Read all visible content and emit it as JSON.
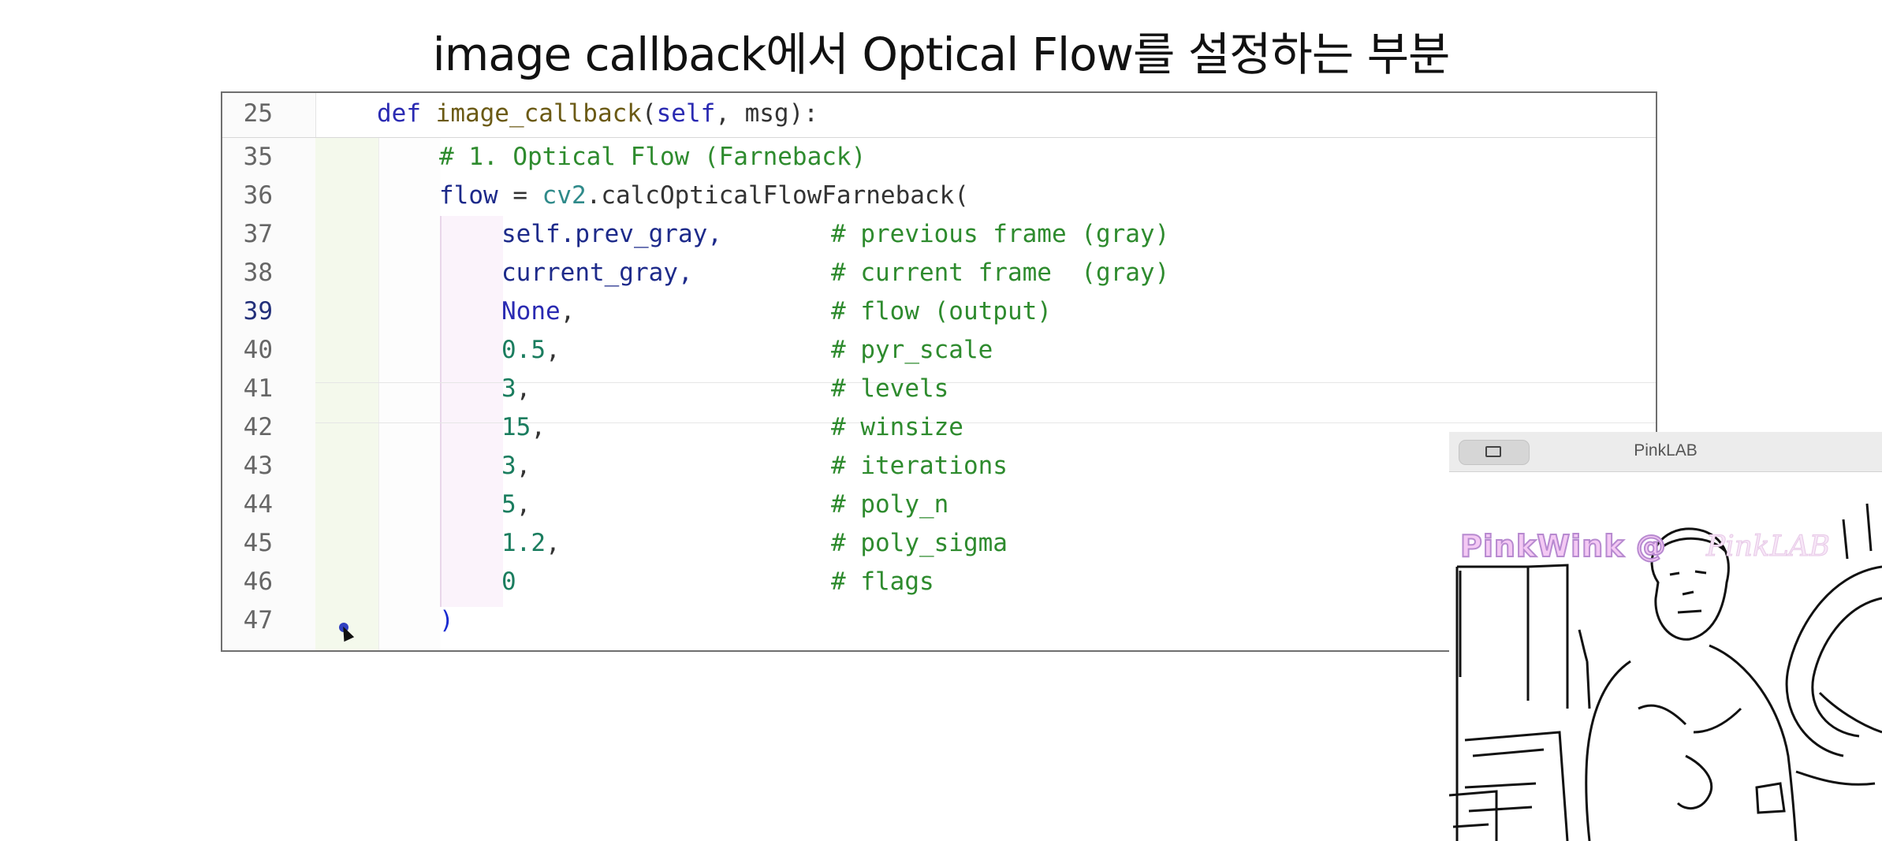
{
  "slide": {
    "title": "image callback에서 Optical Flow를 설정하는 부분"
  },
  "editor": {
    "current_line": "39",
    "lines": [
      {
        "n": "25",
        "indent": 0,
        "segs": [
          [
            "kw",
            "def "
          ],
          [
            "fn",
            "image_callback"
          ],
          [
            "plain",
            "("
          ],
          [
            "self",
            "self"
          ],
          [
            "plain",
            ", msg):"
          ]
        ]
      },
      {
        "n": "35",
        "indent": 1,
        "segs": [
          [
            "cm",
            "# 1. Optical Flow (Farneback)"
          ]
        ]
      },
      {
        "n": "36",
        "indent": 1,
        "segs": [
          [
            "var",
            "flow"
          ],
          [
            "plain",
            " = "
          ],
          [
            "mod",
            "cv2"
          ],
          [
            "plain",
            ".calcOpticalFlowFarneback("
          ]
        ]
      },
      {
        "n": "37",
        "indent": 2,
        "segs": [
          [
            "var",
            "self.prev_gray,"
          ]
        ],
        "comment": "# previous frame (gray)"
      },
      {
        "n": "38",
        "indent": 2,
        "segs": [
          [
            "var",
            "current_gray,"
          ]
        ],
        "comment": "# current frame  (gray)"
      },
      {
        "n": "39",
        "indent": 2,
        "segs": [
          [
            "kw",
            "None"
          ],
          [
            "plain",
            ","
          ]
        ],
        "comment": "# flow (output)"
      },
      {
        "n": "40",
        "indent": 2,
        "segs": [
          [
            "num",
            "0.5"
          ],
          [
            "plain",
            ","
          ]
        ],
        "comment": "# pyr_scale"
      },
      {
        "n": "41",
        "indent": 2,
        "segs": [
          [
            "num",
            "3"
          ],
          [
            "plain",
            ","
          ]
        ],
        "comment": "# levels"
      },
      {
        "n": "42",
        "indent": 2,
        "segs": [
          [
            "num",
            "15"
          ],
          [
            "plain",
            ","
          ]
        ],
        "comment": "# winsize"
      },
      {
        "n": "43",
        "indent": 2,
        "segs": [
          [
            "num",
            "3"
          ],
          [
            "plain",
            ","
          ]
        ],
        "comment": "# iterations"
      },
      {
        "n": "44",
        "indent": 2,
        "segs": [
          [
            "num",
            "5"
          ],
          [
            "plain",
            ","
          ]
        ],
        "comment": "# poly_n"
      },
      {
        "n": "45",
        "indent": 2,
        "segs": [
          [
            "num",
            "1.2"
          ],
          [
            "plain",
            ","
          ]
        ],
        "comment": "# poly_sigma"
      },
      {
        "n": "46",
        "indent": 2,
        "segs": [
          [
            "num",
            "0"
          ]
        ],
        "comment": "# flags"
      },
      {
        "n": "47",
        "indent": 1,
        "segs": [
          [
            "brk",
            ")"
          ]
        ]
      }
    ]
  },
  "camera_window": {
    "title": "PinkLAB",
    "overlay_text": "PinkWink @",
    "overlay_text_2": "PinkLAB"
  }
}
